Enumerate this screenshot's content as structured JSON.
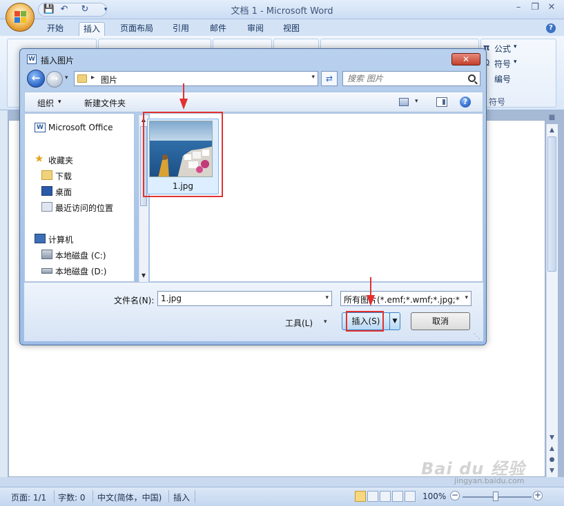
{
  "word": {
    "title": "文档 1 - Microsoft Word",
    "tabs": [
      "开始",
      "插入",
      "页面布局",
      "引用",
      "邮件",
      "审阅",
      "视图"
    ],
    "active_tab": "插入",
    "ribbon": {
      "formula_label": "公式",
      "symbol_label": "符号",
      "numbering_label": "编号",
      "symbol_group_label": "符号"
    },
    "status": {
      "page": "页面: 1/1",
      "words": "字数: 0",
      "language": "中文(简体，中国)",
      "mode": "插入",
      "zoom": "100%"
    }
  },
  "dialog": {
    "title": "插入图片",
    "address_path": "图片",
    "search_placeholder": "搜索 图片",
    "commands": {
      "organize": "组织",
      "new_folder": "新建文件夹"
    },
    "nav": {
      "microsoft_office": "Microsoft Office",
      "favorites": "收藏夹",
      "downloads": "下载",
      "desktop": "桌面",
      "recent": "最近访问的位置",
      "computer": "计算机",
      "drive_c": "本地磁盘 (C:)",
      "drive_d": "本地磁盘 (D:)"
    },
    "file": {
      "name": "1.jpg"
    },
    "filename_label": "文件名(N):",
    "filename_value": "1.jpg",
    "filetype_value": "所有图片(*.emf;*.wmf;*.jpg;*.jp",
    "tools_label": "工具(L)",
    "insert_label": "插入(S)",
    "cancel_label": "取消"
  },
  "watermark": {
    "main": "Bai du 经验",
    "sub": "jingyan.baidu.com"
  },
  "colors": {
    "annotation_red": "#e23030",
    "word_blue": "#2b579a"
  }
}
